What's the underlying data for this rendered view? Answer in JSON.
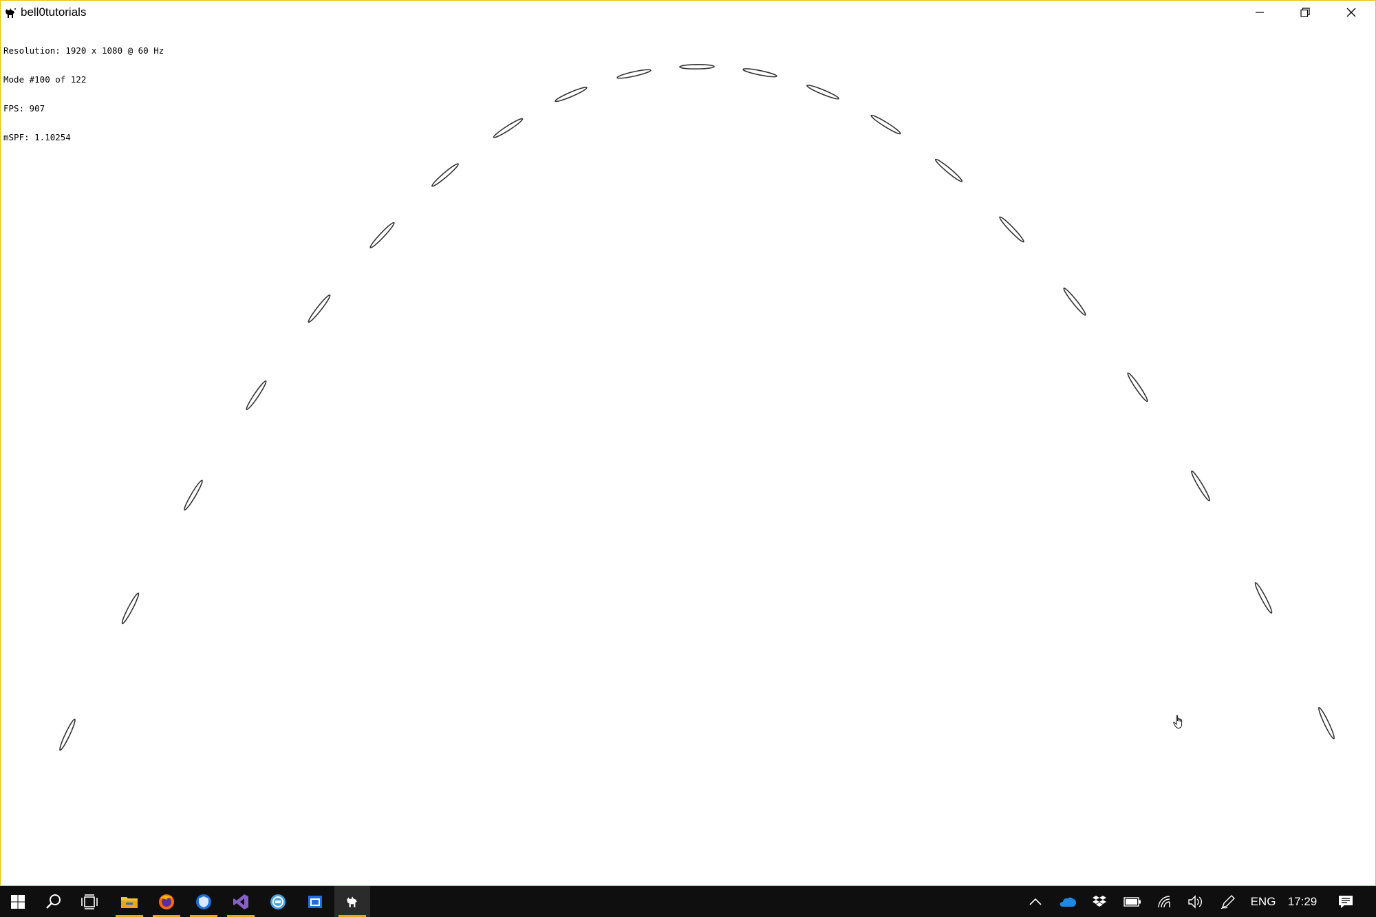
{
  "window": {
    "title": "bell0tutorials"
  },
  "overlay": {
    "resolution": "Resolution: 1920 x 1080 @ 60 Hz",
    "mode": "Mode #100 of 122",
    "fps": "FPS: 907",
    "mspf": "mSPF: 1.10254"
  },
  "taskbar": {
    "pinned": [
      {
        "icon": "windows-start-icon"
      },
      {
        "icon": "search-icon"
      },
      {
        "icon": "task-view-icon"
      },
      {
        "icon": "file-explorer-icon"
      },
      {
        "icon": "firefox-icon"
      },
      {
        "icon": "shield-app-icon"
      },
      {
        "icon": "visual-studio-icon"
      },
      {
        "icon": "network-globe-icon"
      },
      {
        "icon": "blue-window-app-icon"
      },
      {
        "icon": "bell0tutorials-app-icon"
      }
    ],
    "tray": {
      "language": "ENG",
      "clock": "17:29"
    }
  },
  "colors": {
    "accent_border": "#e6c200",
    "taskbar_bg": "#0f0f0f",
    "running_indicator": "#e6a817",
    "onedrive_blue": "#1e88e5",
    "vs_purple": "#8661c5",
    "firefox_orange": "#ff6611"
  }
}
